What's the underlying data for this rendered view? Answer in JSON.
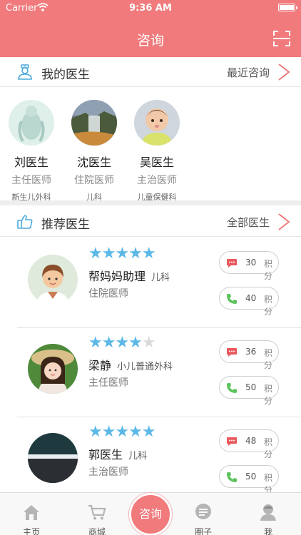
{
  "status": {
    "carrier": "Carrier",
    "time": "9:36 AM"
  },
  "nav": {
    "title": "咨询"
  },
  "my_doctors": {
    "title": "我的医生",
    "link": "最近咨询",
    "items": [
      {
        "name": "刘医生",
        "title": "主任医师",
        "dept": "新生儿外科"
      },
      {
        "name": "沈医生",
        "title": "住院医师",
        "dept": "儿科"
      },
      {
        "name": "吴医生",
        "title": "主治医师",
        "dept": "儿童保健科"
      }
    ]
  },
  "recommended": {
    "title": "推荐医生",
    "link": "全部医生",
    "items": [
      {
        "name": "帮妈妈助理",
        "dept": "儿科",
        "title": "住院医师",
        "rating": 5,
        "msg_points": "30",
        "call_points": "40",
        "unit": "积分"
      },
      {
        "name": "梁静",
        "dept": "小儿普通外科",
        "title": "主任医师",
        "rating": 4,
        "msg_points": "36",
        "call_points": "50",
        "unit": "积分"
      },
      {
        "name": "郭医生",
        "dept": "儿科",
        "title": "主治医师",
        "rating": 5,
        "msg_points": "48",
        "call_points": "50",
        "unit": "积分"
      }
    ]
  },
  "tabbar": {
    "home": "主页",
    "mall": "商城",
    "consult": "咨询",
    "circle": "圈子",
    "me": "我"
  },
  "colors": {
    "brand": "#f07a7c",
    "star": "#5cb8e6",
    "call_green": "#5cc35c",
    "msg_red": "#e8585c"
  }
}
